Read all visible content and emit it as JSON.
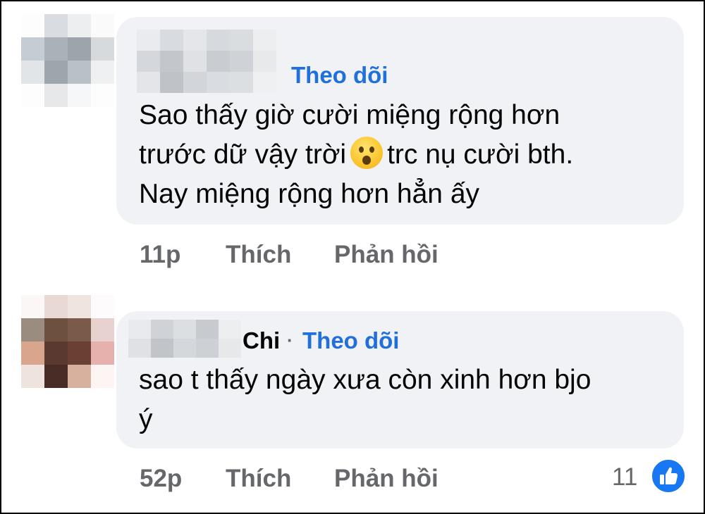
{
  "comments": [
    {
      "author": "",
      "follow_label": "Theo dõi",
      "lines": [
        "Sao thấy giờ cười miệng rộng hơn",
        "trước dữ vậy trời",
        "trc nụ cười bth.",
        "Nay miệng rộng hơn hẳn ấy"
      ],
      "emoji": "astonished-face-icon",
      "time": "11p",
      "like_label": "Thích",
      "reply_label": "Phản hồi"
    },
    {
      "author": "Chi",
      "separator": "·",
      "follow_label": "Theo dõi",
      "lines": [
        "sao t thấy ngày xưa còn xinh hơn bjo",
        "ý"
      ],
      "time": "52p",
      "like_label": "Thích",
      "reply_label": "Phản hồi",
      "reaction_count": "11",
      "reaction_icon": "like-thumb-icon"
    }
  ],
  "colors": {
    "follow": "#216fdb",
    "bubble": "#f0f2f5",
    "meta": "#65676b",
    "like_badge": "#1877f2"
  }
}
